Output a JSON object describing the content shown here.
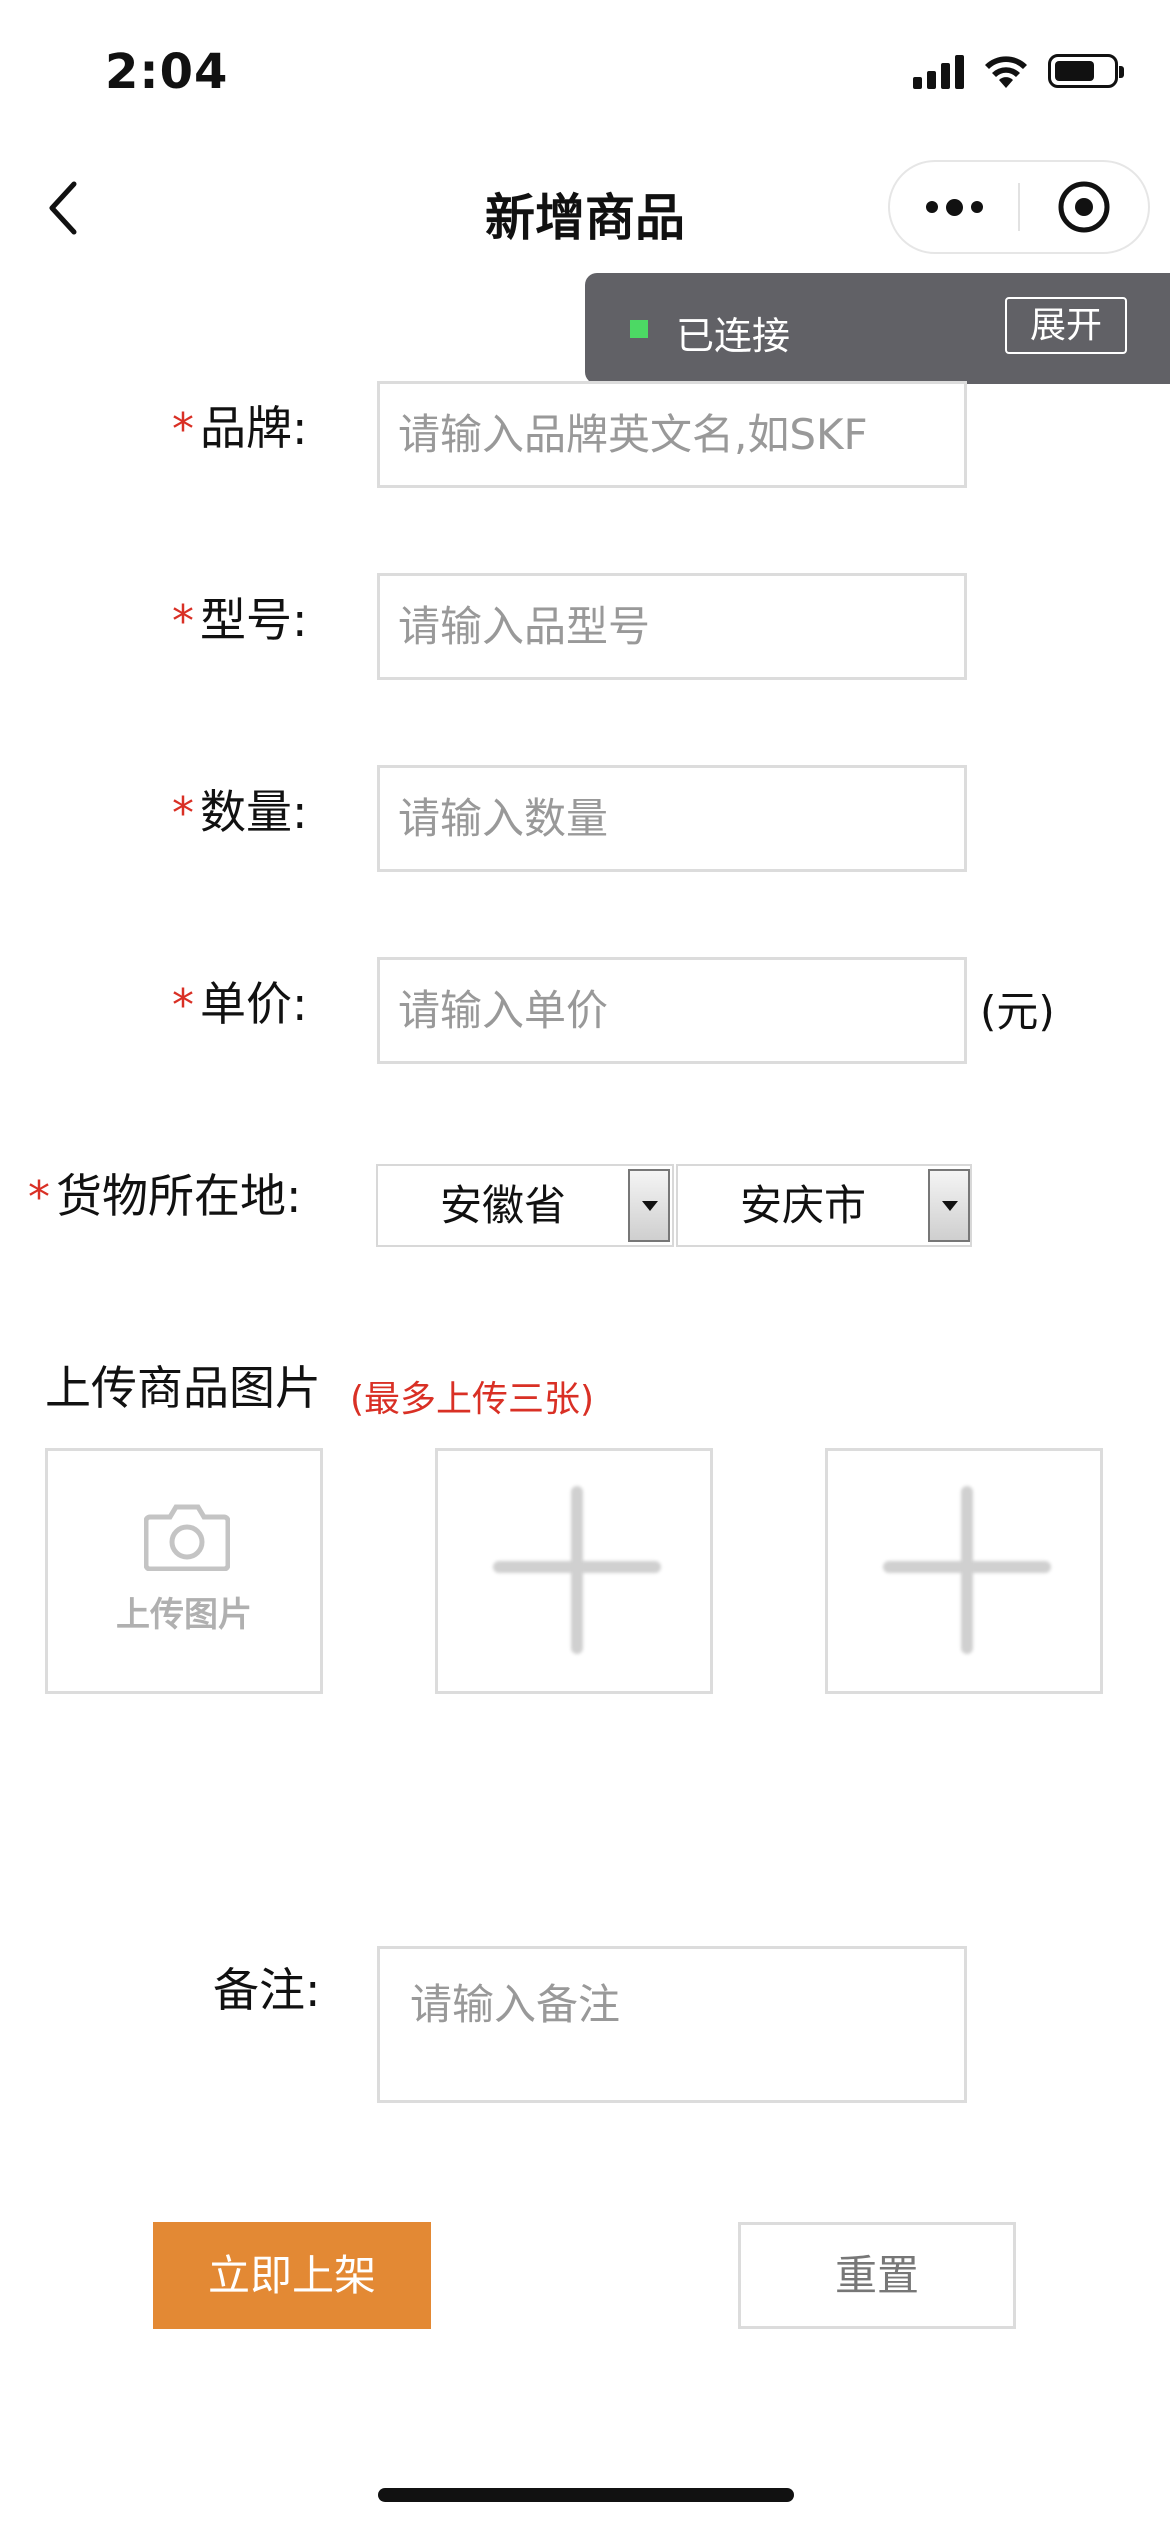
{
  "status_bar": {
    "time": "2:04",
    "icons": [
      "signal-icon",
      "wifi-icon",
      "battery-icon"
    ]
  },
  "nav": {
    "title": "新增商品",
    "back_icon": "chevron-left-icon",
    "more_icon": "more-dots-icon",
    "close_icon": "target-icon"
  },
  "connection": {
    "status": "已连接",
    "expand_label": "展开",
    "indicator_color": "#4cd964"
  },
  "form": {
    "required_mark": "*",
    "brand": {
      "label": "品牌:",
      "placeholder": "请输入品牌英文名,如SKF"
    },
    "model": {
      "label": "型号:",
      "placeholder": "请输入品型号"
    },
    "quantity": {
      "label": "数量:",
      "placeholder": "请输入数量"
    },
    "price": {
      "label": "单价:",
      "placeholder": "请输入单价",
      "unit": "(元)"
    },
    "location": {
      "label": "货物所在地:",
      "province": "安徽省",
      "city": "安庆市"
    },
    "upload": {
      "title": "上传商品图片",
      "hint": "(最多上传三张)",
      "first_label": "上传图片"
    },
    "remarks": {
      "label": "备注:",
      "placeholder": "请输入备注"
    }
  },
  "actions": {
    "submit_label": "立即上架",
    "reset_label": "重置"
  },
  "colors": {
    "accent": "#e38934",
    "required": "#d93025",
    "banner": "#616166"
  }
}
